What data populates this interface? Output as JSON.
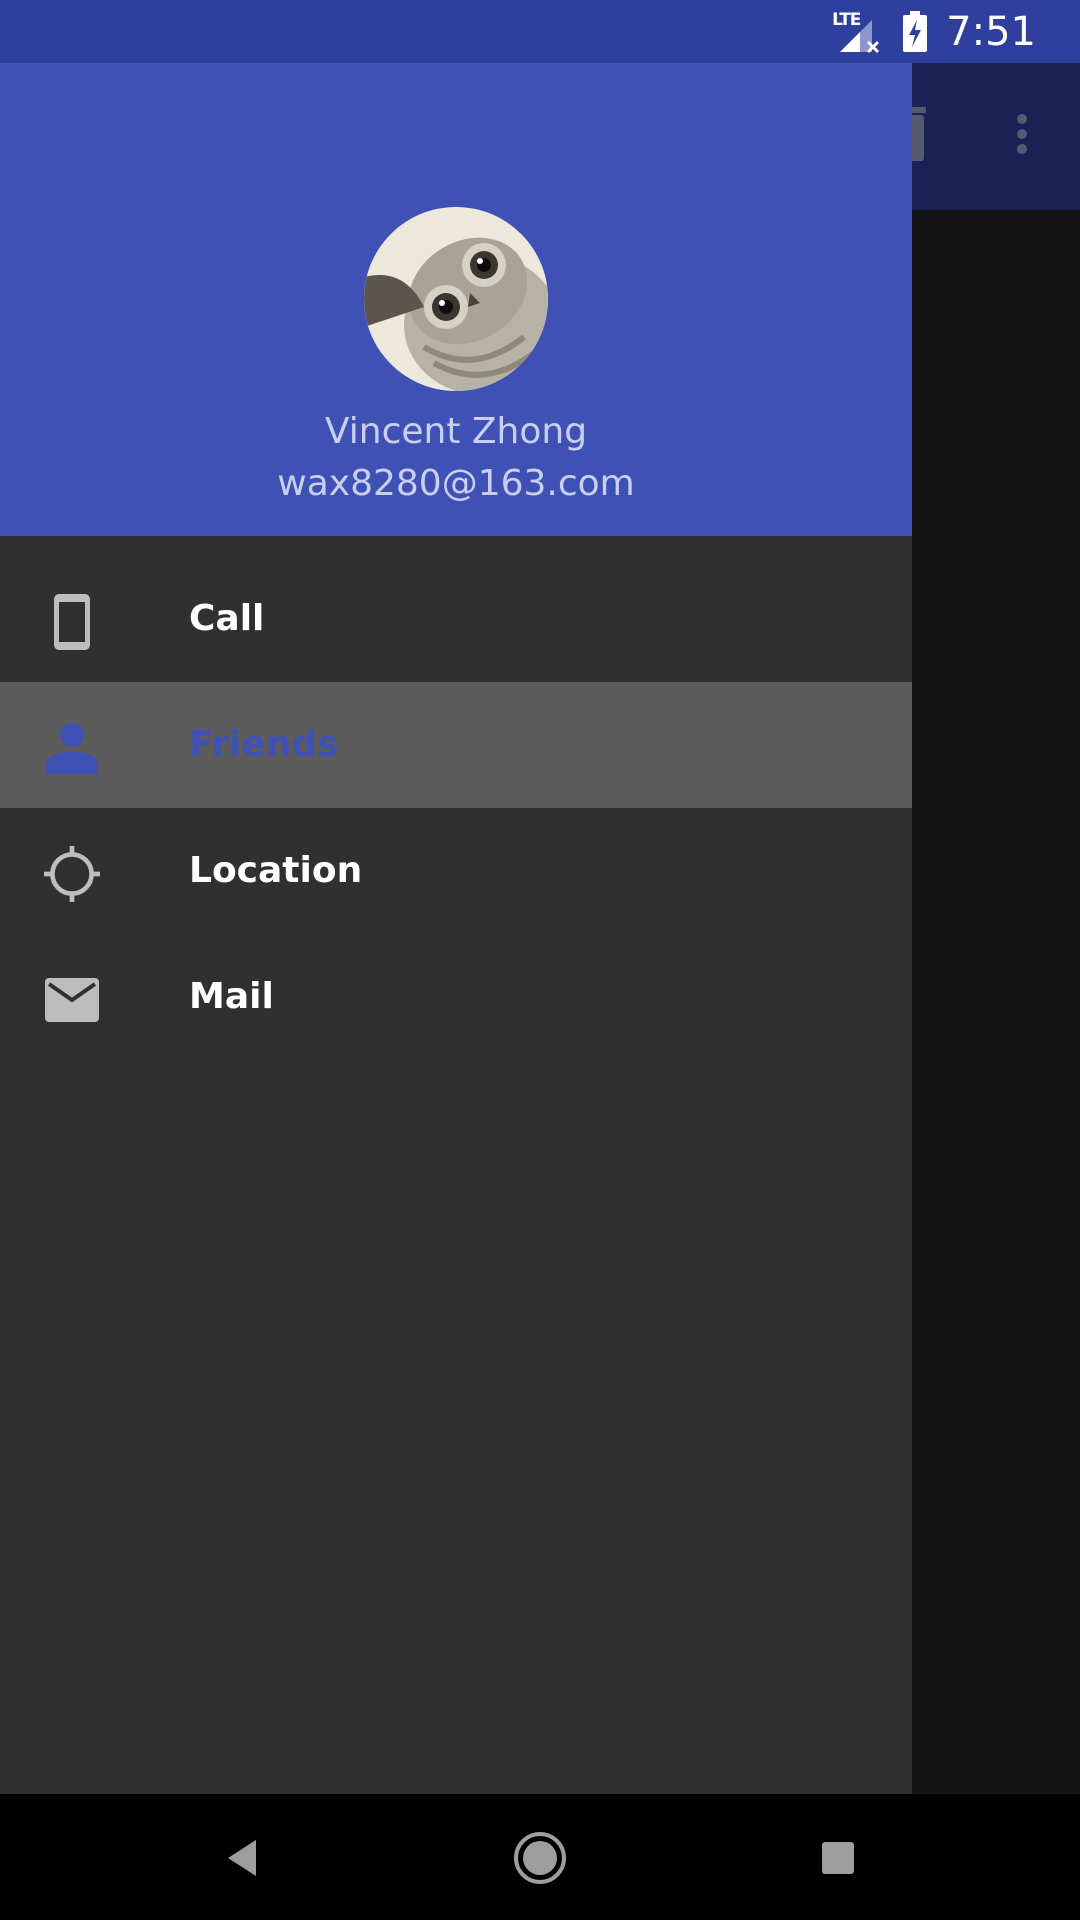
{
  "status_bar": {
    "network_label": "LTE",
    "time": "7:51"
  },
  "drawer": {
    "header": {
      "name": "Vincent Zhong",
      "email": "wax8280@163.com",
      "accent_color": "#3f51b5"
    },
    "menu": [
      {
        "label": "Call",
        "icon": "smartphone-icon",
        "selected": false
      },
      {
        "label": "Friends",
        "icon": "person-icon",
        "selected": true
      },
      {
        "label": "Location",
        "icon": "gps-location-icon",
        "selected": false
      },
      {
        "label": "Mail",
        "icon": "mail-icon",
        "selected": false
      }
    ]
  },
  "colors": {
    "status_bar": "#2f3f9e",
    "primary": "#3f51b5",
    "drawer_background": "#303030",
    "selected_background": "#5c5c5c"
  }
}
